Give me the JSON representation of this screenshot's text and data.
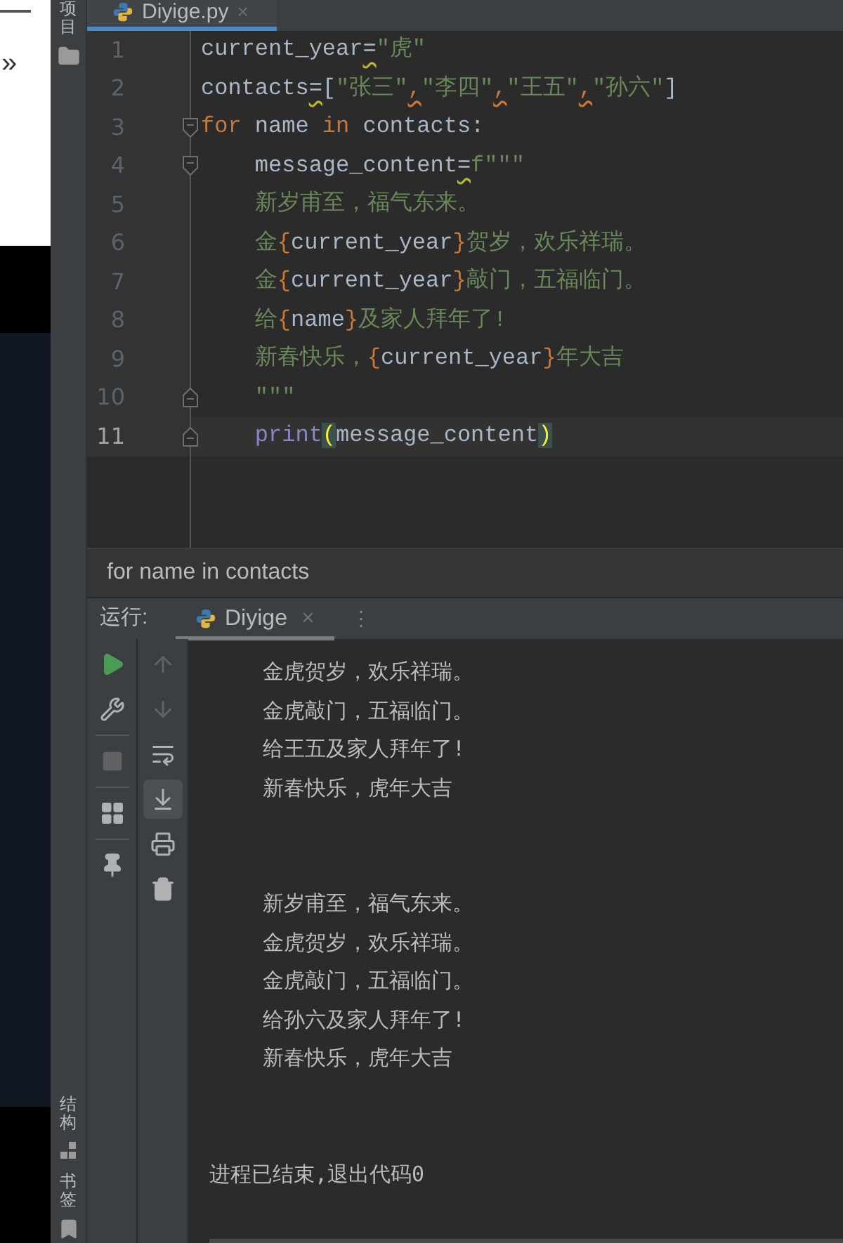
{
  "left_strip": {
    "glyph": "»"
  },
  "side_tools": [
    {
      "label": "项目",
      "kind": "folder"
    },
    {
      "label": "结构",
      "kind": "structure"
    },
    {
      "label": "书签",
      "kind": "bookmark"
    }
  ],
  "editor_tab": {
    "title": "Diyige.py",
    "close": "×",
    "selected": true
  },
  "code": {
    "lines": [
      {
        "number": "1",
        "current": false,
        "kind": "plain",
        "tokens": [
          {
            "text": "current_year",
            "kind": "ident"
          },
          {
            "text": "=",
            "kind": "warn"
          },
          {
            "text": "\"虎\"",
            "kind": "string"
          }
        ]
      },
      {
        "number": "2",
        "current": false,
        "kind": "plain",
        "tokens": [
          {
            "text": "contacts",
            "kind": "ident"
          },
          {
            "text": "=",
            "kind": "warn"
          },
          {
            "text": "[",
            "kind": "ident"
          },
          {
            "text": "\"张三\"",
            "kind": "string"
          },
          {
            "text": ",",
            "kind": "comma"
          },
          {
            "text": "\"李四\"",
            "kind": "string"
          },
          {
            "text": ",",
            "kind": "comma"
          },
          {
            "text": "\"王五\"",
            "kind": "string"
          },
          {
            "text": ",",
            "kind": "comma"
          },
          {
            "text": "\"孙六\"",
            "kind": "string"
          },
          {
            "text": "]",
            "kind": "ident"
          }
        ]
      },
      {
        "number": "3",
        "current": false,
        "kind": "fold_start",
        "tokens": [
          {
            "text": "for",
            "kind": "keyword"
          },
          {
            "text": " name ",
            "kind": "ident"
          },
          {
            "text": "in",
            "kind": "keyword"
          },
          {
            "text": " contacts:",
            "kind": "ident"
          }
        ]
      },
      {
        "number": "4",
        "current": false,
        "kind": "fold_start",
        "tokens": [
          {
            "text": "    message_content",
            "kind": "ident"
          },
          {
            "text": "=",
            "kind": "warn"
          },
          {
            "text": "f\"\"\"",
            "kind": "string"
          }
        ]
      },
      {
        "number": "5",
        "current": false,
        "kind": "plain",
        "tokens": [
          {
            "text": "    新岁甫至，福气东来。",
            "kind": "string"
          }
        ]
      },
      {
        "number": "6",
        "current": false,
        "kind": "plain",
        "tokens": [
          {
            "text": "    金",
            "kind": "string"
          },
          {
            "text": "{",
            "kind": "brace"
          },
          {
            "text": "current_year",
            "kind": "ident"
          },
          {
            "text": "}",
            "kind": "brace"
          },
          {
            "text": "贺岁，欢乐祥瑞。",
            "kind": "string"
          }
        ]
      },
      {
        "number": "7",
        "current": false,
        "kind": "plain",
        "tokens": [
          {
            "text": "    金",
            "kind": "string"
          },
          {
            "text": "{",
            "kind": "brace"
          },
          {
            "text": "current_year",
            "kind": "ident"
          },
          {
            "text": "}",
            "kind": "brace"
          },
          {
            "text": "敲门，五福临门。",
            "kind": "string"
          }
        ]
      },
      {
        "number": "8",
        "current": false,
        "kind": "plain",
        "tokens": [
          {
            "text": "    给",
            "kind": "string"
          },
          {
            "text": "{",
            "kind": "brace"
          },
          {
            "text": "name",
            "kind": "ident"
          },
          {
            "text": "}",
            "kind": "brace"
          },
          {
            "text": "及家人拜年了!",
            "kind": "string"
          }
        ]
      },
      {
        "number": "9",
        "current": false,
        "kind": "plain",
        "tokens": [
          {
            "text": "    新春快乐，",
            "kind": "string"
          },
          {
            "text": "{",
            "kind": "brace"
          },
          {
            "text": "current_year",
            "kind": "ident"
          },
          {
            "text": "}",
            "kind": "brace"
          },
          {
            "text": "年大吉",
            "kind": "string"
          }
        ]
      },
      {
        "number": "10",
        "current": false,
        "kind": "fold_end",
        "tokens": [
          {
            "text": "    \"\"\"",
            "kind": "string"
          }
        ]
      },
      {
        "number": "11",
        "current": true,
        "kind": "fold_end",
        "tokens": [
          {
            "text": "    print",
            "kind": "builtin"
          },
          {
            "text": "(",
            "kind": "paren_match"
          },
          {
            "text": "message_content",
            "kind": "ident"
          },
          {
            "text": ")",
            "kind": "paren_match"
          }
        ]
      }
    ]
  },
  "breadcrumb": "for name in contacts",
  "run_panel": {
    "label": "运行:",
    "tab": {
      "title": "Diyige",
      "close": "×",
      "selected": true
    },
    "more": "⋮",
    "tools_left": [
      {
        "kind": "play",
        "disabled": false,
        "selected": false
      },
      {
        "kind": "wrench",
        "disabled": false,
        "selected": false
      },
      {
        "kind": "separator"
      },
      {
        "kind": "stop",
        "disabled": true,
        "selected": false
      },
      {
        "kind": "separator"
      },
      {
        "kind": "layout",
        "disabled": false,
        "selected": false
      },
      {
        "kind": "separator"
      },
      {
        "kind": "pin",
        "disabled": false,
        "selected": false
      }
    ],
    "tools_right": [
      {
        "kind": "up",
        "disabled": true,
        "selected": false
      },
      {
        "kind": "down",
        "disabled": true,
        "selected": false
      },
      {
        "kind": "wrap",
        "disabled": false,
        "selected": false
      },
      {
        "kind": "scroll_end",
        "disabled": false,
        "selected": true
      },
      {
        "kind": "print",
        "disabled": false,
        "selected": false
      },
      {
        "kind": "trash",
        "disabled": false,
        "selected": false
      }
    ],
    "console": [
      {
        "kind": "output",
        "text": "金虎贺岁，欢乐祥瑞。"
      },
      {
        "kind": "output",
        "text": "金虎敲门，五福临门。"
      },
      {
        "kind": "output",
        "text": "给王五及家人拜年了!"
      },
      {
        "kind": "output",
        "text": "新春快乐，虎年大吉"
      },
      {
        "kind": "blank"
      },
      {
        "kind": "blank"
      },
      {
        "kind": "output",
        "text": "新岁甫至，福气东来。"
      },
      {
        "kind": "output",
        "text": "金虎贺岁，欢乐祥瑞。"
      },
      {
        "kind": "output",
        "text": "金虎敲门，五福临门。"
      },
      {
        "kind": "output",
        "text": "给孙六及家人拜年了!"
      },
      {
        "kind": "output",
        "text": "新春快乐，虎年大吉"
      },
      {
        "kind": "blank"
      },
      {
        "kind": "blank"
      },
      {
        "kind": "status",
        "text": "进程已结束,退出代码0"
      }
    ]
  }
}
